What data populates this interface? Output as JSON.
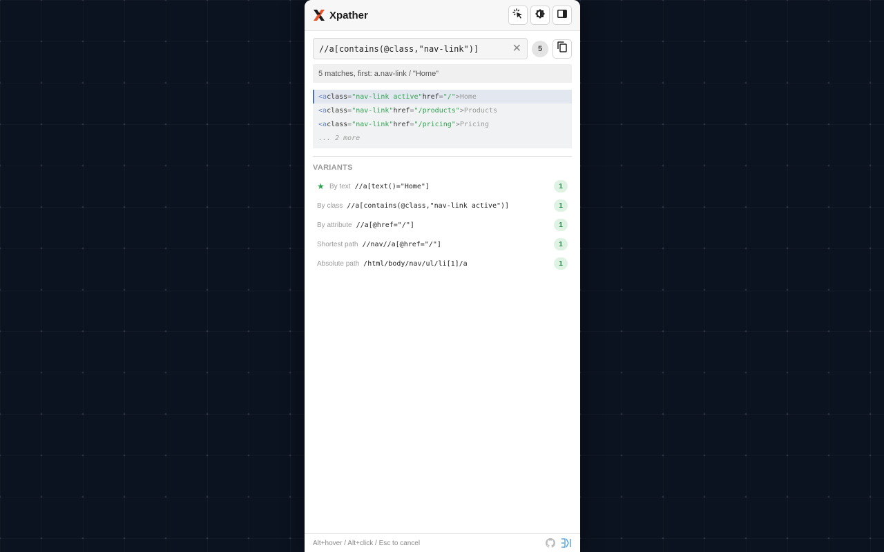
{
  "app": {
    "title": "Xpather",
    "logo_icon": "xpather-logo-icon",
    "accent_color": "#e8542a"
  },
  "header": {
    "buttons": [
      {
        "icon": "pointer-select-icon"
      },
      {
        "icon": "theme-toggle-icon"
      },
      {
        "icon": "sidebar-toggle-icon"
      }
    ]
  },
  "search": {
    "value": "//a[contains(@class,\"nav-link\")]",
    "clear_icon": "close-icon",
    "match_count": "5",
    "copy_icon": "copy-icon"
  },
  "status": {
    "text": "5 matches, first: a.nav-link / \"Home\""
  },
  "results": [
    {
      "tag": "a",
      "attrs": [
        {
          "name": "class",
          "value": "nav-link active"
        },
        {
          "name": "href",
          "value": "/"
        }
      ],
      "text": "Home",
      "active": true
    },
    {
      "tag": "a",
      "attrs": [
        {
          "name": "class",
          "value": "nav-link"
        },
        {
          "name": "href",
          "value": "/products"
        }
      ],
      "text": "Products",
      "active": false
    },
    {
      "tag": "a",
      "attrs": [
        {
          "name": "class",
          "value": "nav-link"
        },
        {
          "name": "href",
          "value": "/pricing"
        }
      ],
      "text": "Pricing",
      "active": false
    }
  ],
  "results_more": "... 2 more",
  "variants": {
    "title": "VARIANTS",
    "items": [
      {
        "label": "By text",
        "xpath": "//a[text()=\"Home\"]",
        "count": "1",
        "starred": true
      },
      {
        "label": "By class",
        "xpath": "//a[contains(@class,\"nav-link active\")]",
        "count": "1",
        "starred": false
      },
      {
        "label": "By attribute",
        "xpath": "//a[@href=\"/\"]",
        "count": "1",
        "starred": false
      },
      {
        "label": "Shortest path",
        "xpath": "//nav//a[@href=\"/\"]",
        "count": "1",
        "starred": false
      },
      {
        "label": "Absolute path",
        "xpath": "/html/body/nav/ul/li[1]/a",
        "count": "1",
        "starred": false
      }
    ]
  },
  "footer": {
    "hint": "Alt+hover / Alt+click / Esc to cancel",
    "github_icon": "github-icon",
    "brand_icon": "brand-logo-icon"
  }
}
